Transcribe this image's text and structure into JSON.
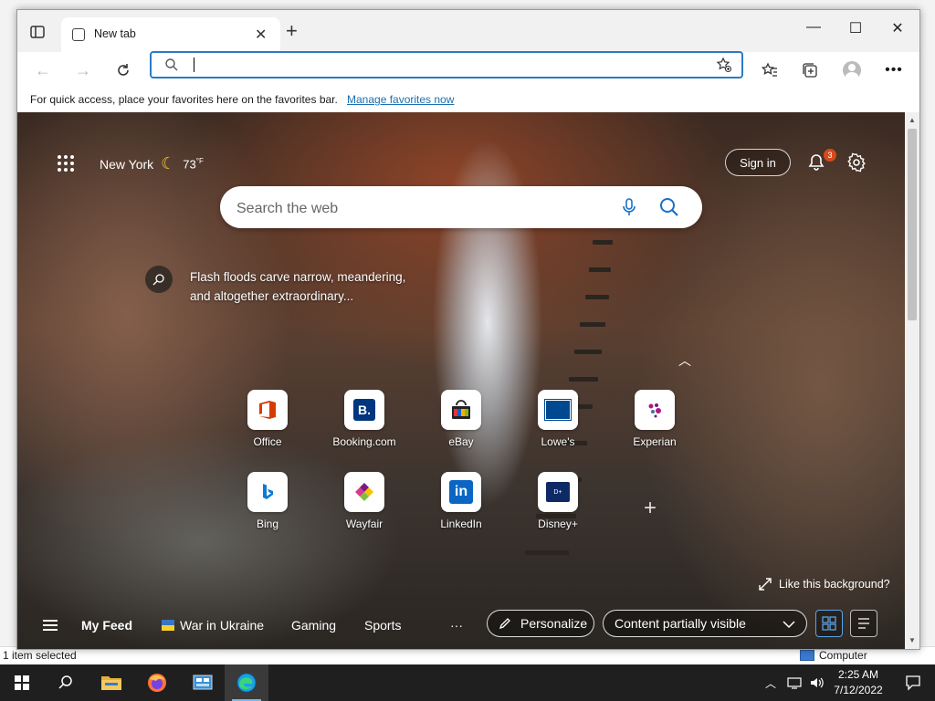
{
  "desktop": {
    "status_left": "1 item selected",
    "status_right": "Computer"
  },
  "browser": {
    "tab_title": "New tab",
    "address_value": "",
    "favorites_bar": {
      "message": "For quick access, place your favorites here on the favorites bar.",
      "link": "Manage favorites now"
    }
  },
  "newtab": {
    "weather": {
      "city": "New York",
      "temp": "73",
      "unit": "°F"
    },
    "sign_in": "Sign in",
    "notifications_count": "3",
    "search_placeholder": "Search the web",
    "story": "Flash floods carve narrow, meandering, and altogether extraordinary...",
    "quick_links": [
      {
        "label": "Office",
        "icon": "office-icon"
      },
      {
        "label": "Booking.com",
        "icon": "booking-icon"
      },
      {
        "label": "eBay",
        "icon": "ebay-icon"
      },
      {
        "label": "Lowe's",
        "icon": "lowes-icon"
      },
      {
        "label": "Experian",
        "icon": "experian-icon"
      },
      {
        "label": "Bing",
        "icon": "bing-icon"
      },
      {
        "label": "Wayfair",
        "icon": "wayfair-icon"
      },
      {
        "label": "LinkedIn",
        "icon": "linkedin-icon"
      },
      {
        "label": "Disney+",
        "icon": "disney-icon"
      }
    ],
    "like_background": "Like this background?",
    "feed": {
      "my_feed": "My Feed",
      "items": [
        "War in Ukraine",
        "Gaming",
        "Sports"
      ],
      "more": "···",
      "personalize": "Personalize",
      "content_visibility": "Content partially visible"
    }
  },
  "taskbar": {
    "time": "2:25 AM",
    "date": "7/12/2022"
  }
}
